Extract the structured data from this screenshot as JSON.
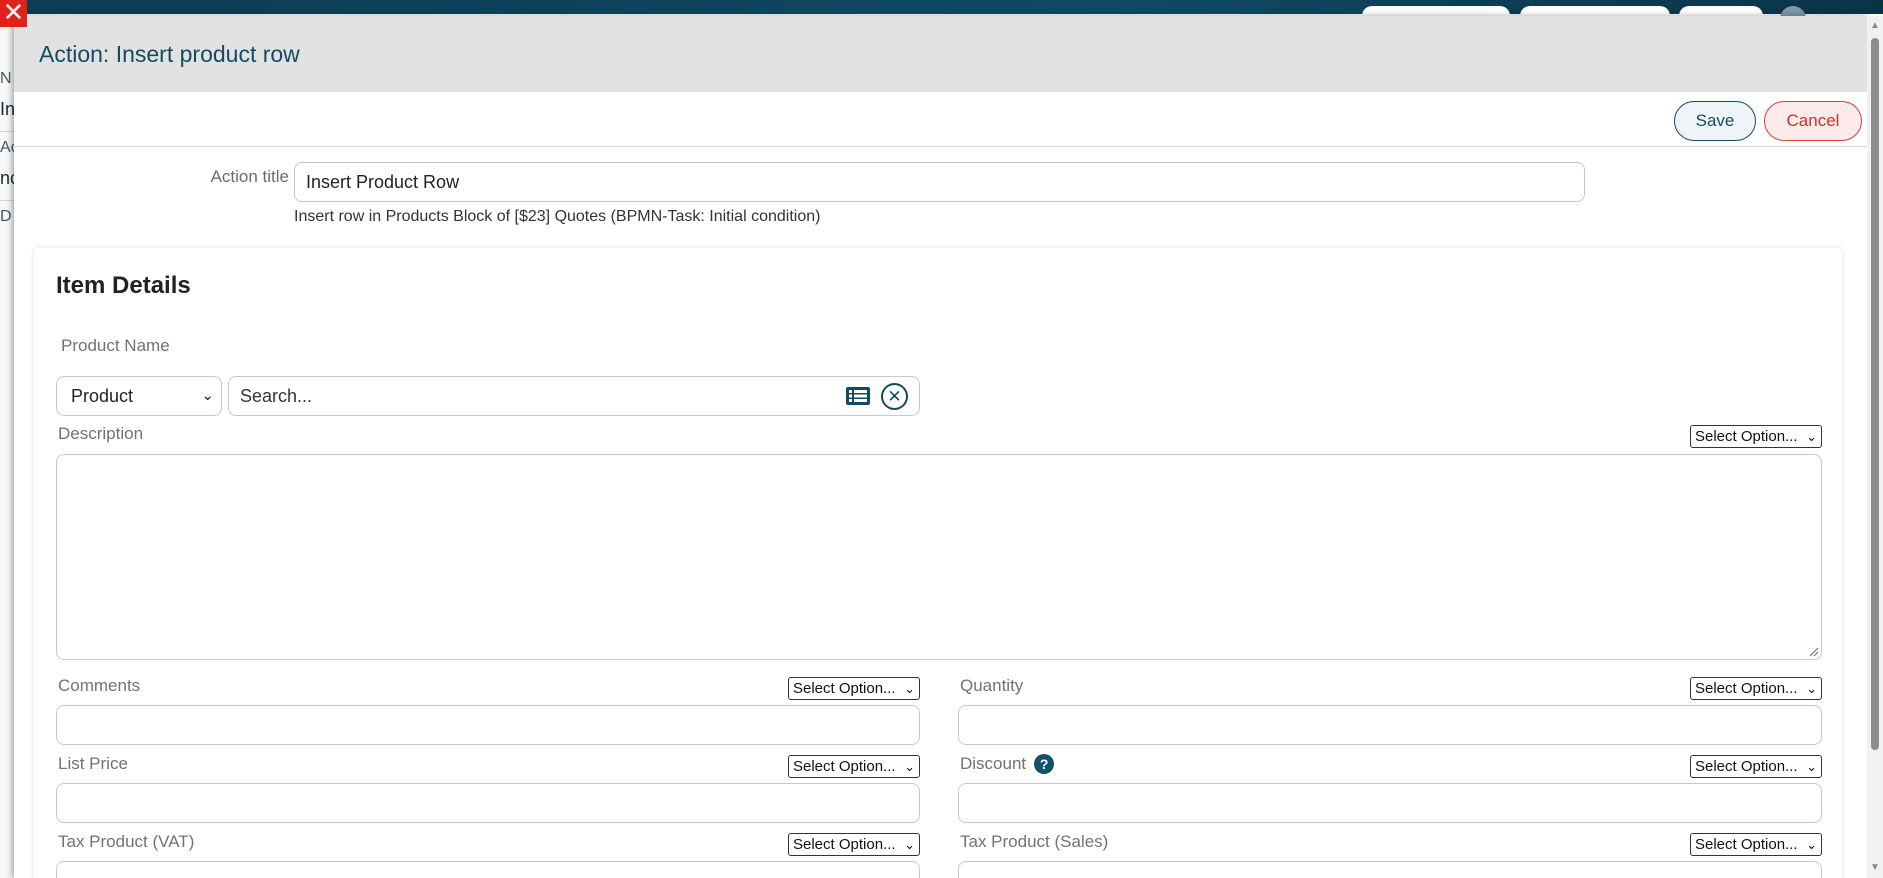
{
  "background": {
    "fragments": [
      "N",
      "In",
      "Ac",
      "nc",
      "D"
    ]
  },
  "modal": {
    "title": "Action: Insert product row",
    "save_label": "Save",
    "cancel_label": "Cancel",
    "action_title_label": "Action title",
    "action_title_value": "Insert Product Row",
    "action_description": "Insert row in Products Block of [$23] Quotes (BPMN-Task: Initial condition)"
  },
  "item_details": {
    "heading": "Item Details",
    "product_name_label": "Product Name",
    "product_type_selected": "Product",
    "search_placeholder": "Search...",
    "description_label": "Description",
    "select_option": "Select Option...",
    "fields": {
      "comments": "Comments",
      "quantity": "Quantity",
      "list_price": "List Price",
      "discount": "Discount",
      "tax_vat": "Tax Product (VAT)",
      "tax_sales": "Tax Product (Sales)"
    }
  },
  "colors": {
    "brand": "#124b63",
    "cancel": "#d3302b",
    "close": "#e0201b"
  }
}
